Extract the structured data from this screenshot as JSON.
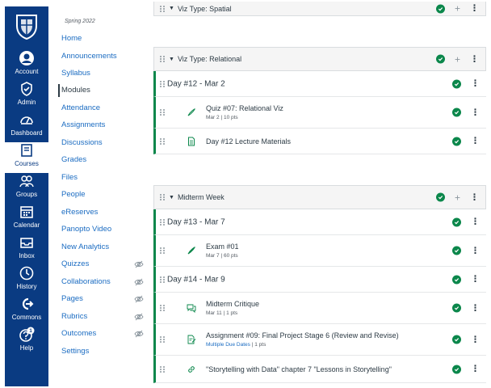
{
  "global_nav": {
    "items": [
      {
        "label": "Account",
        "icon": "account-icon"
      },
      {
        "label": "Admin",
        "icon": "admin-icon"
      },
      {
        "label": "Dashboard",
        "icon": "dashboard-icon"
      },
      {
        "label": "Courses",
        "icon": "courses-icon"
      },
      {
        "label": "Groups",
        "icon": "groups-icon"
      },
      {
        "label": "Calendar",
        "icon": "calendar-icon"
      },
      {
        "label": "Inbox",
        "icon": "inbox-icon"
      },
      {
        "label": "History",
        "icon": "history-icon"
      },
      {
        "label": "Commons",
        "icon": "commons-icon"
      },
      {
        "label": "Help",
        "icon": "help-icon",
        "badge": "1"
      }
    ],
    "active": "Courses",
    "colors": {
      "background": "#0a3b82",
      "text": "#ffffff"
    }
  },
  "course_nav": {
    "term": "Spring 2022",
    "items": [
      {
        "label": "Home"
      },
      {
        "label": "Announcements"
      },
      {
        "label": "Syllabus"
      },
      {
        "label": "Modules"
      },
      {
        "label": "Attendance"
      },
      {
        "label": "Assignments"
      },
      {
        "label": "Discussions"
      },
      {
        "label": "Grades"
      },
      {
        "label": "Files"
      },
      {
        "label": "People"
      },
      {
        "label": "eReserves"
      },
      {
        "label": "Panopto Video"
      },
      {
        "label": "New Analytics"
      },
      {
        "label": "Quizzes"
      },
      {
        "label": "Collaborations"
      },
      {
        "label": "Pages"
      },
      {
        "label": "Rubrics"
      },
      {
        "label": "Outcomes"
      },
      {
        "label": "Settings"
      }
    ],
    "active": "Modules",
    "link_color": "#1b6cc2"
  },
  "modules": {
    "viz_spatial": {
      "title": "Viz Type: Spatial"
    },
    "viz_relational": {
      "title": "Viz Type: Relational",
      "day12": {
        "title": "Day #12 - Mar 2"
      },
      "quiz07": {
        "title": "Quiz #07: Relational Viz",
        "date": "Mar 2",
        "points": "10 pts"
      },
      "day12_materials": {
        "title": "Day #12 Lecture Materials"
      }
    },
    "midterm": {
      "title": "Midterm Week",
      "day13": {
        "title": "Day #13 - Mar 7"
      },
      "exam01": {
        "title": "Exam #01",
        "date": "Mar 7",
        "points": "60 pts"
      },
      "day14": {
        "title": "Day #14 - Mar 9"
      },
      "critique": {
        "title": "Midterm Critique",
        "date": "Mar 11",
        "points": "1 pts"
      },
      "assignment09": {
        "title": "Assignment #09: Final Project Stage 6 (Review and Revise)",
        "due": "Multiple Due Dates",
        "points": "1 pts"
      },
      "storytelling": {
        "title": "\"Storytelling with Data\" chapter 7 \"Lessons in Storytelling\""
      }
    },
    "sep": "|",
    "colors": {
      "published": "#0b874b",
      "header_bg": "#f5f5f5"
    }
  }
}
